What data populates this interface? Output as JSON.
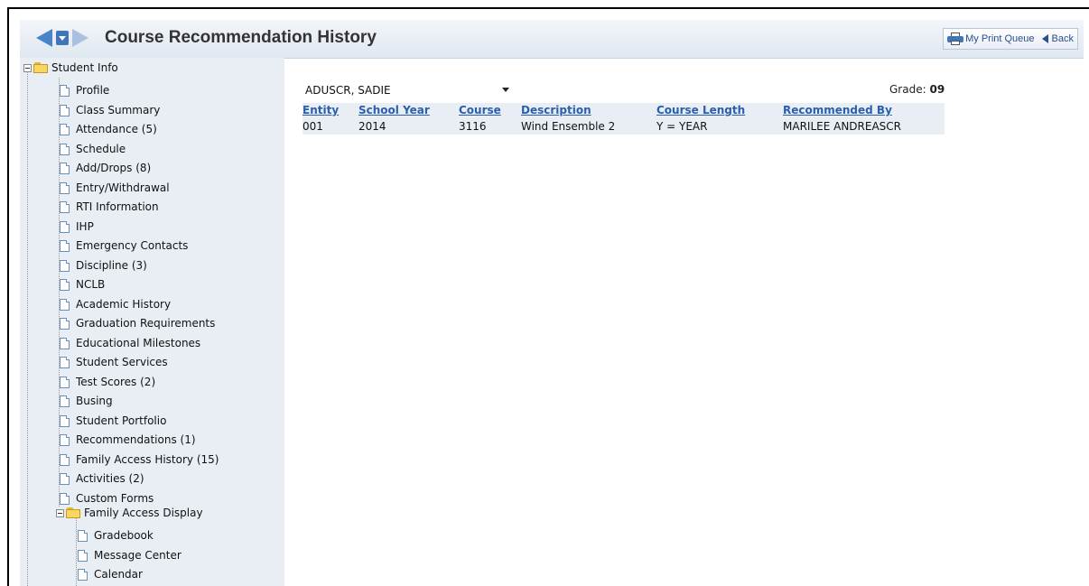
{
  "header": {
    "title": "Course Recommendation History",
    "print_queue_label": "My Print Queue",
    "back_label": "Back"
  },
  "sidebar": {
    "root_label": "Student Info",
    "items": [
      {
        "label": "Profile"
      },
      {
        "label": "Class Summary"
      },
      {
        "label": "Attendance (5)"
      },
      {
        "label": "Schedule"
      },
      {
        "label": "Add/Drops (8)"
      },
      {
        "label": "Entry/Withdrawal"
      },
      {
        "label": "RTI Information"
      },
      {
        "label": "IHP"
      },
      {
        "label": "Emergency Contacts"
      },
      {
        "label": "Discipline (3)"
      },
      {
        "label": "NCLB"
      },
      {
        "label": "Academic History"
      },
      {
        "label": "Graduation Requirements"
      },
      {
        "label": "Educational Milestones"
      },
      {
        "label": "Student Services"
      },
      {
        "label": "Test Scores (2)"
      },
      {
        "label": "Busing"
      },
      {
        "label": "Student Portfolio"
      },
      {
        "label": "Recommendations (1)"
      },
      {
        "label": "Family Access History (15)"
      },
      {
        "label": "Activities (2)"
      },
      {
        "label": "Custom Forms"
      }
    ],
    "subfolder_label": "Family Access Display",
    "subitems": [
      {
        "label": "Gradebook"
      },
      {
        "label": "Message Center"
      },
      {
        "label": "Calendar"
      }
    ]
  },
  "student_select": {
    "value": "ADUSCR, SADIE"
  },
  "grade": {
    "label": "Grade:",
    "value": "09"
  },
  "table": {
    "headers": [
      "Entity",
      "School Year",
      "Course",
      "Description",
      "Course Length",
      "Recommended By"
    ],
    "rows": [
      [
        "001",
        "2014",
        "3116",
        "Wind Ensemble 2",
        "Y = YEAR",
        "MARILEE ANDREASCR"
      ]
    ]
  },
  "colors": {
    "link": "#2a5fae",
    "sidebar_bg": "#e9eef5",
    "folder": "#f8d760"
  }
}
